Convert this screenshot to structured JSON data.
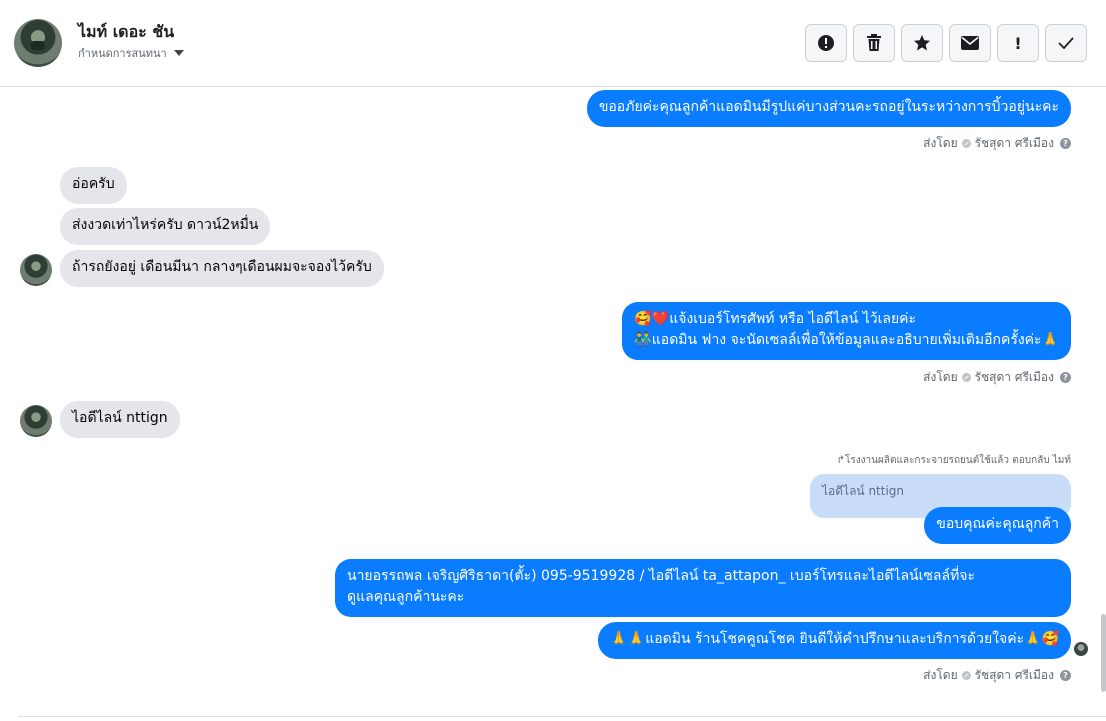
{
  "header": {
    "name": "ไมท์ เดอะ ชัน",
    "subtitle": "กำหนดการสนทนา",
    "actions": [
      {
        "icon": "alert-circle-icon",
        "label": "Spam"
      },
      {
        "icon": "trash-icon",
        "label": "Delete"
      },
      {
        "icon": "star-icon",
        "label": "Star"
      },
      {
        "icon": "envelope-icon",
        "label": "Mark unread"
      },
      {
        "icon": "exclamation-icon",
        "label": "!"
      },
      {
        "icon": "check-icon",
        "label": "Done"
      }
    ],
    "action_glyphs": {
      "exclamation": "!"
    }
  },
  "messages": {
    "m1": "ขออภัยค่ะคุณลูกค้าแอดมินมีรูปแค่บางส่วนคะรถอยู่ในระหว่างการบิ้วอยู่นะคะ",
    "m2": "อ่อครับ",
    "m3": "ส่งงวดเท่าไหร่ครับ ดาวน์2หมื่น",
    "m4": "ถ้ารถยังอยู่ เดือนมีนา กลางๆเดือนผมจะจองไว้ครับ",
    "m5_line1": "🥰❤️แจ้งเบอร์โทรศัพท์ หรือ ไอดีไลน์  ไว้เลยค่ะ",
    "m5_line2": "👬แอดมิน ฟาง จะนัดเซลล์เพื่อให้ข้อมูลและอธิบายเพิ่มเติมอีกครั้งค่ะ🙏",
    "m6": "ไอดีไลน์ nttign",
    "reply_note": "↱โรงงานผลิตและกระจายรถยนต์ใช้แล้ว ตอบกลับ ไมท์",
    "quoted": "ไอดีไลน์ nttign",
    "m7": "ขอบคุณค่ะคุณลูกค้า",
    "m8_line1": "นายอรรถพล เจริญศิริธาดา(ตั้ะ)       095-9519928 / ไอดีไลน์ ta_attapon_  เบอร์โทรและไอดีไลน์เซลล์ที่จะ",
    "m8_line2": "ดูแลคุณลูกค้านะคะ",
    "m9": "🙏🙏แอดมิน ร้านโชคคูณโชค ยินดีให้คำปรึกษาและบริการด้วยใจค่ะ🙏🥰"
  },
  "sent_by": {
    "prefix": "ส่งโดย",
    "name": "รัชสุดา ศรีเมือง",
    "help": "?"
  }
}
